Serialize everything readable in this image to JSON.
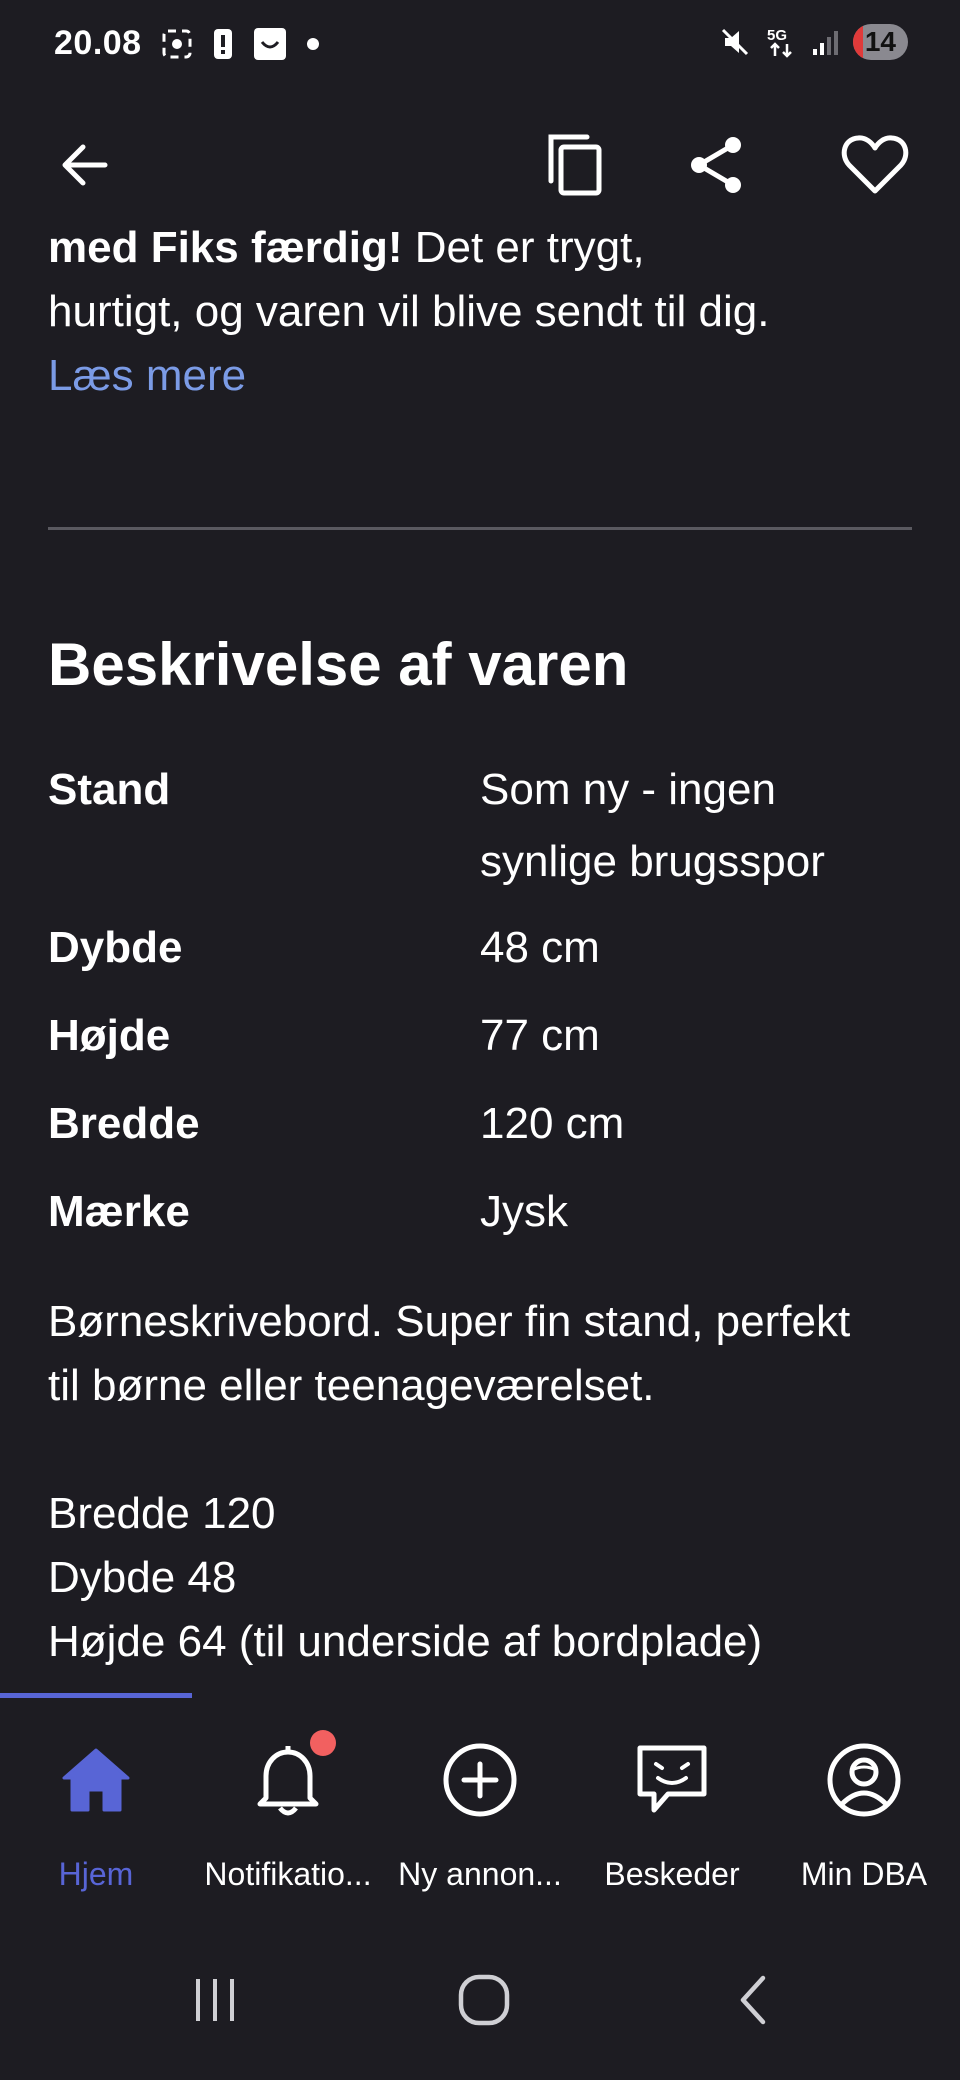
{
  "status_bar": {
    "time": "20.08",
    "battery": "14",
    "network": "5G"
  },
  "toolbar": {
    "back_icon": "arrow-left-icon",
    "copy_icon": "copy-icon",
    "share_icon": "share-icon",
    "favorite_icon": "heart-icon"
  },
  "intro": {
    "bold_text": "med Fiks færdig!",
    "text": " Det er trygt, hurtigt, og varen vil blive sendt til dig. ",
    "link_label": "Læs mere"
  },
  "description_section": {
    "title": "Beskrivelse af varen",
    "specs": [
      {
        "label": "Stand",
        "value": "Som ny - ingen synlige brugsspor"
      },
      {
        "label": "Dybde",
        "value": "48 cm"
      },
      {
        "label": "Højde",
        "value": "77 cm"
      },
      {
        "label": "Bredde",
        "value": "120 cm"
      },
      {
        "label": "Mærke",
        "value": "Jysk"
      }
    ],
    "body": "Børneskrivebord. Super fin stand, perfekt til børne eller teenageværelset.\n\nBredde 120\nDybde 48\nHøjde 64 (til underside af bordplade)"
  },
  "bottom_nav": {
    "items": [
      {
        "label": "Hjem",
        "icon": "home-icon",
        "active": true
      },
      {
        "label": "Notifikatio...",
        "icon": "bell-icon",
        "badge": true
      },
      {
        "label": "Ny annon...",
        "icon": "plus-circle-icon"
      },
      {
        "label": "Beskeder",
        "icon": "chat-icon"
      },
      {
        "label": "Min DBA",
        "icon": "profile-icon"
      }
    ]
  },
  "colors": {
    "background": "#1d1c22",
    "accent": "#5865d6",
    "link": "#7b9be6",
    "badge": "#f26060"
  }
}
